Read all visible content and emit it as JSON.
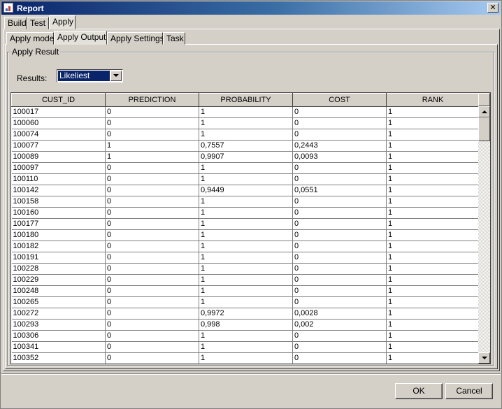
{
  "window": {
    "title": "Report",
    "close_glyph": "✕"
  },
  "tabs": [
    "Build",
    "Test",
    "Apply"
  ],
  "subtabs": [
    "Apply model",
    "Apply Output",
    "Apply Settings",
    "Task"
  ],
  "group_label": "Apply Result",
  "results": {
    "label": "Results:",
    "value": "Likeliest"
  },
  "table": {
    "columns": [
      "CUST_ID",
      "PREDICTION",
      "PROBABILITY",
      "COST",
      "RANK"
    ],
    "rows": [
      [
        "100017",
        "0",
        "1",
        "0",
        "1"
      ],
      [
        "100060",
        "0",
        "1",
        "0",
        "1"
      ],
      [
        "100074",
        "0",
        "1",
        "0",
        "1"
      ],
      [
        "100077",
        "1",
        "0,7557",
        "0,2443",
        "1"
      ],
      [
        "100089",
        "1",
        "0,9907",
        "0,0093",
        "1"
      ],
      [
        "100097",
        "0",
        "1",
        "0",
        "1"
      ],
      [
        "100110",
        "0",
        "1",
        "0",
        "1"
      ],
      [
        "100142",
        "0",
        "0,9449",
        "0,0551",
        "1"
      ],
      [
        "100158",
        "0",
        "1",
        "0",
        "1"
      ],
      [
        "100160",
        "0",
        "1",
        "0",
        "1"
      ],
      [
        "100177",
        "0",
        "1",
        "0",
        "1"
      ],
      [
        "100180",
        "0",
        "1",
        "0",
        "1"
      ],
      [
        "100182",
        "0",
        "1",
        "0",
        "1"
      ],
      [
        "100191",
        "0",
        "1",
        "0",
        "1"
      ],
      [
        "100228",
        "0",
        "1",
        "0",
        "1"
      ],
      [
        "100229",
        "0",
        "1",
        "0",
        "1"
      ],
      [
        "100248",
        "0",
        "1",
        "0",
        "1"
      ],
      [
        "100265",
        "0",
        "1",
        "0",
        "1"
      ],
      [
        "100272",
        "0",
        "0,9972",
        "0,0028",
        "1"
      ],
      [
        "100293",
        "0",
        "0,998",
        "0,002",
        "1"
      ],
      [
        "100306",
        "0",
        "1",
        "0",
        "1"
      ],
      [
        "100341",
        "0",
        "1",
        "0",
        "1"
      ],
      [
        "100352",
        "0",
        "1",
        "0",
        "1"
      ]
    ]
  },
  "buttons": {
    "ok": "OK",
    "cancel": "Cancel"
  }
}
